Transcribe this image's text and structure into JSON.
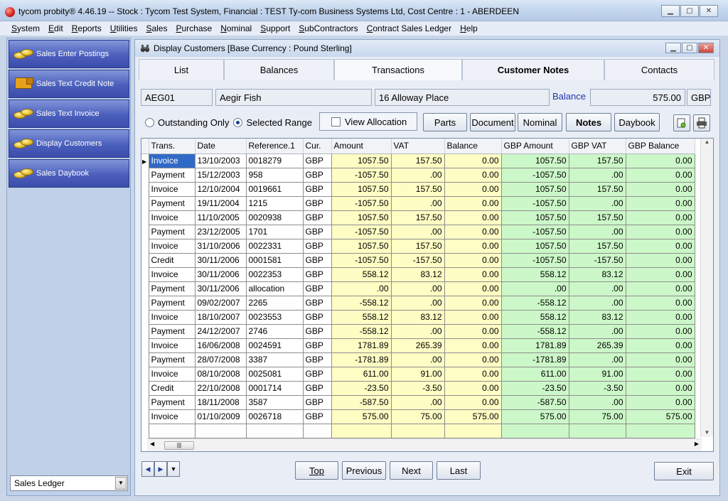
{
  "window": {
    "title": "tycom probity® 4.46.19 -- Stock : Tycom Test System, Financial : TEST Ty-com Business Systems Ltd, Cost Centre : 1 - ABERDEEN"
  },
  "menu": [
    {
      "label": "System",
      "u": "S",
      "rest": "ystem"
    },
    {
      "label": "Edit",
      "u": "E",
      "rest": "dit"
    },
    {
      "label": "Reports",
      "u": "R",
      "rest": "eports"
    },
    {
      "label": "Utilities",
      "u": "U",
      "rest": "tilities"
    },
    {
      "label": "Sales",
      "u": "S",
      "rest": "ales"
    },
    {
      "label": "Purchase",
      "u": "P",
      "rest": "urchase"
    },
    {
      "label": "Nominal",
      "u": "N",
      "rest": "ominal"
    },
    {
      "label": "Support",
      "u": "S",
      "rest": "upport"
    },
    {
      "label": "SubContractors",
      "u": "S",
      "rest": "ubContractors"
    },
    {
      "label": "Contract Sales Ledger",
      "u": "C",
      "rest": "ontract Sales Ledger"
    },
    {
      "label": "Help",
      "u": "H",
      "rest": "elp"
    }
  ],
  "sidebar": {
    "items": [
      {
        "label": "Sales Enter Postings",
        "icon": "coins-icon"
      },
      {
        "label": "Sales Text Credit Note",
        "icon": "truck-icon"
      },
      {
        "label": "Sales Text Invoice",
        "icon": "coins-icon"
      },
      {
        "label": "Display Customers",
        "icon": "coins-icon"
      },
      {
        "label": "Sales Daybook",
        "icon": "coins-icon"
      }
    ],
    "ledger_select": "Sales Ledger"
  },
  "child": {
    "title": "Display Customers [Base Currency : Pound Sterling]",
    "tabs": [
      {
        "label": "List"
      },
      {
        "label": "Balances"
      },
      {
        "label": "Transactions"
      },
      {
        "label": "Customer Notes"
      },
      {
        "label": "Contacts"
      }
    ],
    "customer": {
      "code": "AEG01",
      "name": "Aegir Fish",
      "address": "16 Alloway Place",
      "balance_label": "Balance",
      "balance": "575.00",
      "currency": "GBP"
    },
    "options": {
      "outstanding": "Outstanding Only",
      "selected_range": "Selected Range",
      "view_allocation": "View Allocation"
    },
    "buttons": {
      "parts": "Parts",
      "document": "Document",
      "nominal": "Nominal",
      "notes": "Notes",
      "daybook": "Daybook"
    },
    "columns": [
      "Trans.",
      "Date",
      "Reference.1",
      "Cur.",
      "Amount",
      "VAT",
      "Balance",
      "GBP Amount",
      "GBP VAT",
      "GBP Balance"
    ],
    "rows": [
      [
        "Invoice",
        "13/10/2003",
        "0018279",
        "GBP",
        "1057.50",
        "157.50",
        "0.00",
        "1057.50",
        "157.50",
        "0.00"
      ],
      [
        "Payment",
        "15/12/2003",
        "958",
        "GBP",
        "-1057.50",
        ".00",
        "0.00",
        "-1057.50",
        ".00",
        "0.00"
      ],
      [
        "Invoice",
        "12/10/2004",
        "0019661",
        "GBP",
        "1057.50",
        "157.50",
        "0.00",
        "1057.50",
        "157.50",
        "0.00"
      ],
      [
        "Payment",
        "19/11/2004",
        "1215",
        "GBP",
        "-1057.50",
        ".00",
        "0.00",
        "-1057.50",
        ".00",
        "0.00"
      ],
      [
        "Invoice",
        "11/10/2005",
        "0020938",
        "GBP",
        "1057.50",
        "157.50",
        "0.00",
        "1057.50",
        "157.50",
        "0.00"
      ],
      [
        "Payment",
        "23/12/2005",
        "1701",
        "GBP",
        "-1057.50",
        ".00",
        "0.00",
        "-1057.50",
        ".00",
        "0.00"
      ],
      [
        "Invoice",
        "31/10/2006",
        "0022331",
        "GBP",
        "1057.50",
        "157.50",
        "0.00",
        "1057.50",
        "157.50",
        "0.00"
      ],
      [
        "Credit",
        "30/11/2006",
        "0001581",
        "GBP",
        "-1057.50",
        "-157.50",
        "0.00",
        "-1057.50",
        "-157.50",
        "0.00"
      ],
      [
        "Invoice",
        "30/11/2006",
        "0022353",
        "GBP",
        "558.12",
        "83.12",
        "0.00",
        "558.12",
        "83.12",
        "0.00"
      ],
      [
        "Payment",
        "30/11/2006",
        "allocation",
        "GBP",
        ".00",
        ".00",
        "0.00",
        ".00",
        ".00",
        "0.00"
      ],
      [
        "Payment",
        "09/02/2007",
        "2265",
        "GBP",
        "-558.12",
        ".00",
        "0.00",
        "-558.12",
        ".00",
        "0.00"
      ],
      [
        "Invoice",
        "18/10/2007",
        "0023553",
        "GBP",
        "558.12",
        "83.12",
        "0.00",
        "558.12",
        "83.12",
        "0.00"
      ],
      [
        "Payment",
        "24/12/2007",
        "2746",
        "GBP",
        "-558.12",
        ".00",
        "0.00",
        "-558.12",
        ".00",
        "0.00"
      ],
      [
        "Invoice",
        "16/06/2008",
        "0024591",
        "GBP",
        "1781.89",
        "265.39",
        "0.00",
        "1781.89",
        "265.39",
        "0.00"
      ],
      [
        "Payment",
        "28/07/2008",
        "3387",
        "GBP",
        "-1781.89",
        ".00",
        "0.00",
        "-1781.89",
        ".00",
        "0.00"
      ],
      [
        "Invoice",
        "08/10/2008",
        "0025081",
        "GBP",
        "611.00",
        "91.00",
        "0.00",
        "611.00",
        "91.00",
        "0.00"
      ],
      [
        "Credit",
        "22/10/2008",
        "0001714",
        "GBP",
        "-23.50",
        "-3.50",
        "0.00",
        "-23.50",
        "-3.50",
        "0.00"
      ],
      [
        "Payment",
        "18/11/2008",
        "3587",
        "GBP",
        "-587.50",
        ".00",
        "0.00",
        "-587.50",
        ".00",
        "0.00"
      ],
      [
        "Invoice",
        "01/10/2009",
        "0026718",
        "GBP",
        "575.00",
        "75.00",
        "575.00",
        "575.00",
        "75.00",
        "575.00"
      ]
    ],
    "nav": {
      "top": "Top",
      "previous": "Previous",
      "next": "Next",
      "last": "Last",
      "exit": "Exit"
    }
  }
}
